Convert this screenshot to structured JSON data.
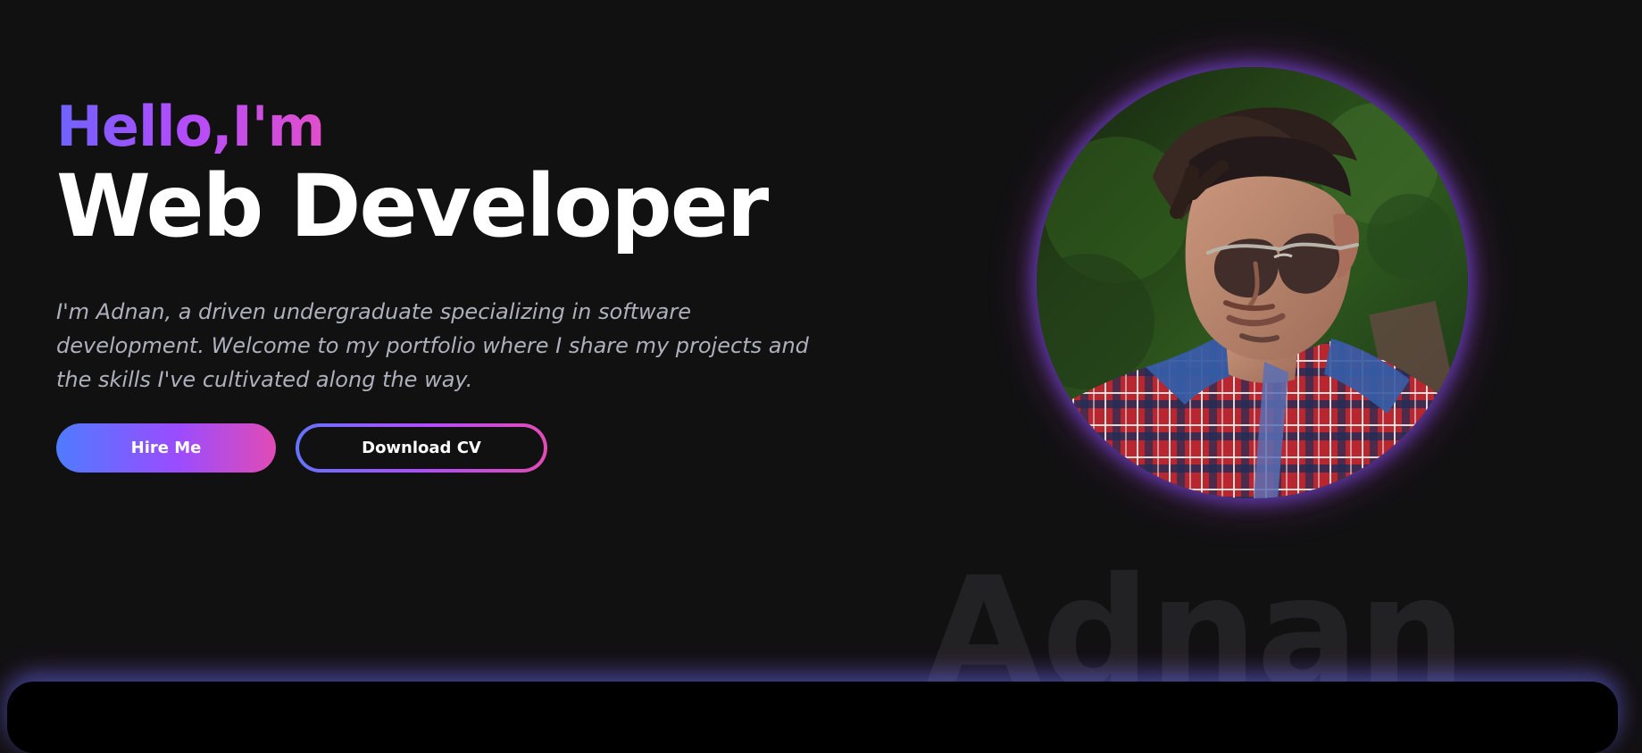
{
  "hero": {
    "greeting": "Hello,I'm",
    "title": "Web Developer",
    "description": "I'm Adnan, a driven undergraduate specializing in software development. Welcome to my portfolio where I share my projects and the skills I've cultivated along the way.",
    "buttons": {
      "primary_label": "Hire Me",
      "secondary_label": "Download CV"
    },
    "watermark": "Adnan"
  },
  "colors": {
    "background": "#111112",
    "accent_start": "#4f7bff",
    "accent_mid": "#9a4cff",
    "accent_end": "#e14bb5",
    "text_primary": "#ffffff",
    "text_muted": "#aeb0bb"
  }
}
